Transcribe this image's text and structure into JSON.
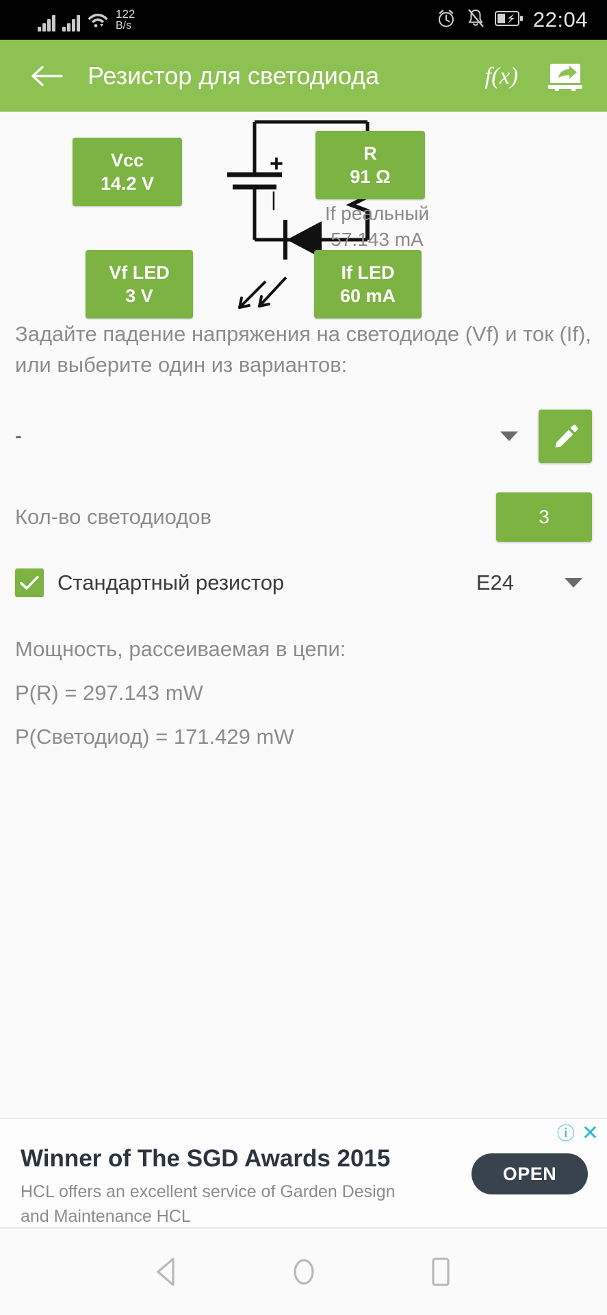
{
  "statusbar": {
    "network_speed_value": "122",
    "network_speed_unit": "B/s",
    "time": "22:04",
    "icons": [
      "signal-bars-icon",
      "signal-bars-icon",
      "wifi-icon",
      "alarm-icon",
      "bell-muted-icon",
      "battery-charging-icon"
    ]
  },
  "appbar": {
    "title": "Резистор для светодиода",
    "back_icon": "back-arrow-icon",
    "fx_label": "f(x)",
    "share_icon": "share-export-icon",
    "color": "#8dc152"
  },
  "circuit": {
    "vcc": {
      "name": "Vcc",
      "value": "14.2 V"
    },
    "resistor": {
      "name": "R",
      "value": "91 Ω"
    },
    "if_real": {
      "label": "If реальный",
      "value": "57.143 mA"
    },
    "vf_led": {
      "name": "Vf LED",
      "value": "3 V"
    },
    "if_led": {
      "name": "If LED",
      "value": "60 mA"
    },
    "battery_plus": "+",
    "battery_minus": "I"
  },
  "instructions": "Задайте падение напряжения на светодиоде (Vf) и ток (If), или выберите один из вариантов:",
  "led_select": {
    "value": "-",
    "edit_icon": "pencil-icon"
  },
  "led_count": {
    "label": "Кол-во светодиодов",
    "value": "3"
  },
  "standard_resistor": {
    "label": "Стандартный резистор",
    "checked": true,
    "series": "E24"
  },
  "power": {
    "heading": "Мощность, рассеиваемая в цепи:",
    "resistor_power": "P(R) = 297.143 mW",
    "led_power": "P(Светодиод) = 171.429 mW"
  },
  "ad": {
    "title": "Winner of The SGD Awards 2015",
    "body": "HCL offers an excellent service of Garden Design and Maintenance HCL",
    "cta": "OPEN",
    "info_badge": "ⓘ",
    "close_badge": "✕"
  },
  "navbar": {
    "back": "nav-back-icon",
    "home": "nav-home-icon",
    "recents": "nav-recents-icon"
  }
}
